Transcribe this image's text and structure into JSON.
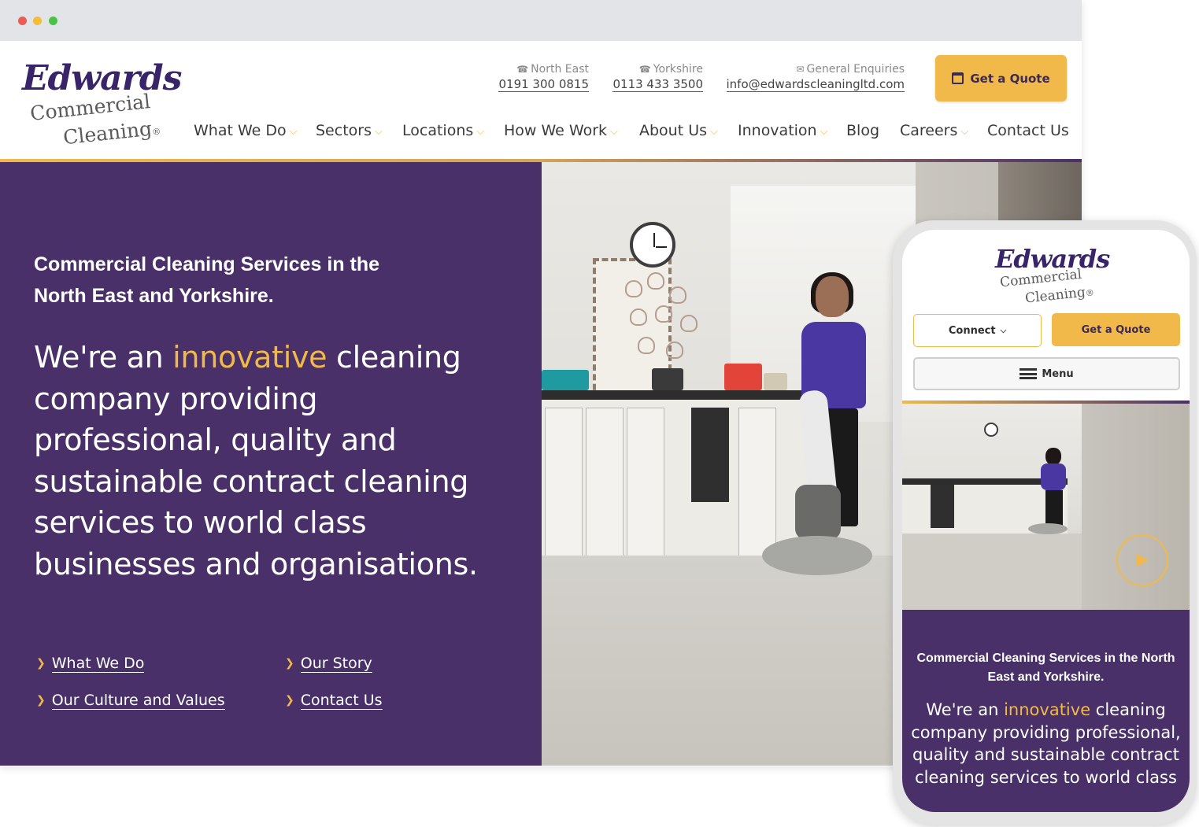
{
  "brand": {
    "logo_script": "Edwards",
    "logo_line1": "Commercial",
    "logo_line2": "Cleaning",
    "logo_reg": "®",
    "colors": {
      "purple": "#4a3069",
      "gold": "#f0b94a",
      "text": "#3a3a3a"
    }
  },
  "header": {
    "contacts": [
      {
        "icon": "phone-icon",
        "label": "North East",
        "value": "0191 300 0815"
      },
      {
        "icon": "phone-icon",
        "label": "Yorkshire",
        "value": "0113 433 3500"
      },
      {
        "icon": "envelope-icon",
        "label": "General Enquiries",
        "value": "info@edwardscleaningltd.com"
      }
    ],
    "quote_button": "Get a Quote",
    "nav": [
      {
        "label": "What We Do",
        "dropdown": true
      },
      {
        "label": "Sectors",
        "dropdown": true
      },
      {
        "label": "Locations",
        "dropdown": true
      },
      {
        "label": "How We Work",
        "dropdown": true
      },
      {
        "label": "About Us",
        "dropdown": true
      },
      {
        "label": "Innovation",
        "dropdown": true
      },
      {
        "label": "Blog",
        "dropdown": false
      },
      {
        "label": "Careers",
        "dropdown": true
      },
      {
        "label": "Contact Us",
        "dropdown": false
      }
    ]
  },
  "hero": {
    "kicker": "Commercial Cleaning Services in the North East and Yorkshire.",
    "main_before": "We're an ",
    "main_highlight": "innovative",
    "main_after": " cleaning company providing professional, quality and sustainable contract cleaning services to world class businesses and organisations.",
    "links": [
      "What We Do",
      "Our Story",
      "Our Culture and Values",
      "Contact Us"
    ]
  },
  "mobile": {
    "connect_button": "Connect",
    "quote_button": "Get a Quote",
    "menu_button": "Menu",
    "kicker": "Commercial Cleaning Services in the North East and Yorkshire.",
    "main_before": "We're an ",
    "main_highlight": "innovative",
    "main_after": " cleaning company providing professional, quality and sustainable contract cleaning services to world class"
  }
}
